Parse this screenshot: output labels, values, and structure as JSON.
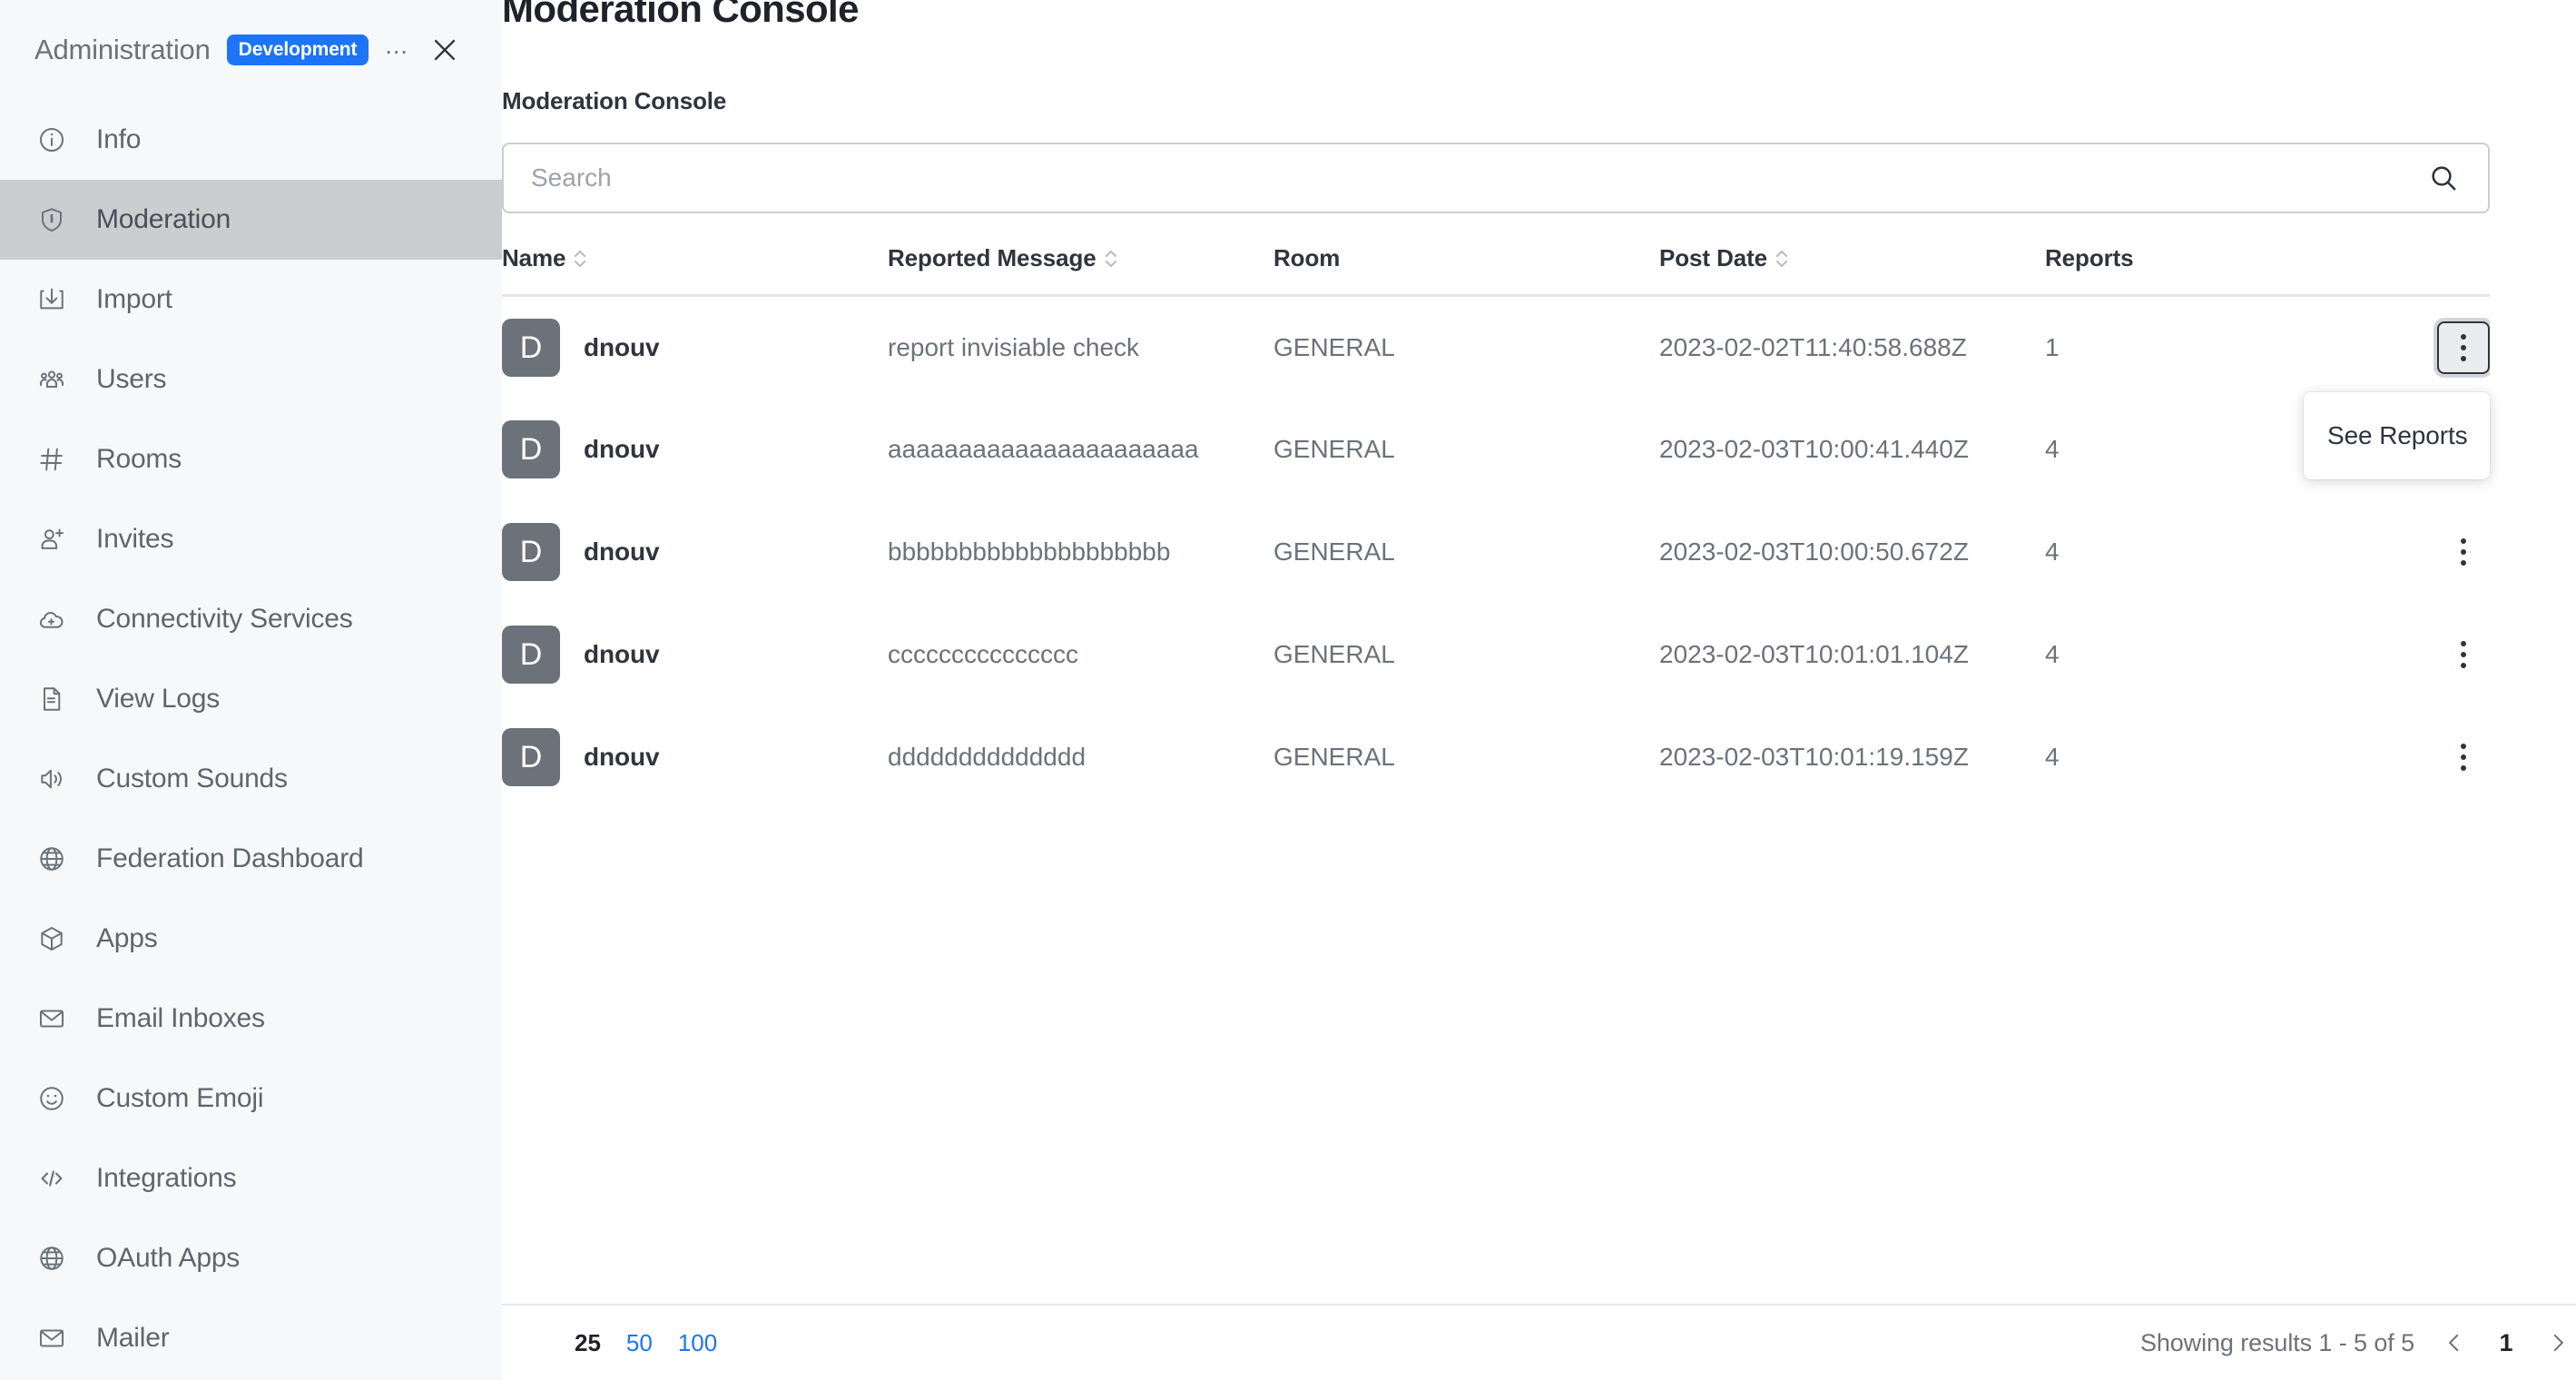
{
  "sidebar": {
    "title": "Administration",
    "badge": "Development",
    "ellipsis": "...",
    "close_icon": "close-icon",
    "items": [
      {
        "label": "Info",
        "icon": "info-circle-icon",
        "active": false
      },
      {
        "label": "Moderation",
        "icon": "shield-icon",
        "active": true
      },
      {
        "label": "Import",
        "icon": "import-download-icon",
        "active": false
      },
      {
        "label": "Users",
        "icon": "users-group-icon",
        "active": false
      },
      {
        "label": "Rooms",
        "icon": "hash-icon",
        "active": false
      },
      {
        "label": "Invites",
        "icon": "user-plus-icon",
        "active": false
      },
      {
        "label": "Connectivity Services",
        "icon": "cloud-plus-icon",
        "active": false
      },
      {
        "label": "View Logs",
        "icon": "document-lines-icon",
        "active": false
      },
      {
        "label": "Custom Sounds",
        "icon": "speaker-icon",
        "active": false
      },
      {
        "label": "Federation Dashboard",
        "icon": "globe-icon",
        "active": false
      },
      {
        "label": "Apps",
        "icon": "cube-icon",
        "active": false
      },
      {
        "label": "Email Inboxes",
        "icon": "envelope-icon",
        "active": false
      },
      {
        "label": "Custom Emoji",
        "icon": "smiley-icon",
        "active": false
      },
      {
        "label": "Integrations",
        "icon": "code-brackets-icon",
        "active": false
      },
      {
        "label": "OAuth Apps",
        "icon": "globe-icon",
        "active": false
      },
      {
        "label": "Mailer",
        "icon": "envelope-icon",
        "active": false
      }
    ]
  },
  "main": {
    "page_title": "Moderation Console",
    "section_label": "Moderation Console",
    "search": {
      "value": "",
      "placeholder": "Search",
      "icon": "search-icon"
    },
    "table": {
      "columns": [
        {
          "label": "Name",
          "sortable": true
        },
        {
          "label": "Reported Message",
          "sortable": true
        },
        {
          "label": "Room",
          "sortable": false
        },
        {
          "label": "Post Date",
          "sortable": true
        },
        {
          "label": "Reports",
          "sortable": false
        }
      ],
      "rows": [
        {
          "avatar_letter": "D",
          "name": "dnouv",
          "message": "report invisiable check",
          "room": "GENERAL",
          "post_date": "2023-02-02T11:40:58.688Z",
          "reports": "1",
          "menu_icon": "kebab-menu-icon"
        },
        {
          "avatar_letter": "D",
          "name": "dnouv",
          "message": "aaaaaaaaaaaaaaaaaaaaaa",
          "room": "GENERAL",
          "post_date": "2023-02-03T10:00:41.440Z",
          "reports": "4",
          "menu_icon": "kebab-menu-icon"
        },
        {
          "avatar_letter": "D",
          "name": "dnouv",
          "message": "bbbbbbbbbbbbbbbbbbbb",
          "room": "GENERAL",
          "post_date": "2023-02-03T10:00:50.672Z",
          "reports": "4",
          "menu_icon": "kebab-menu-icon"
        },
        {
          "avatar_letter": "D",
          "name": "dnouv",
          "message": "ccccccccccccccc",
          "room": "GENERAL",
          "post_date": "2023-02-03T10:01:01.104Z",
          "reports": "4",
          "menu_icon": "kebab-menu-icon"
        },
        {
          "avatar_letter": "D",
          "name": "dnouv",
          "message": "dddddddddddddd",
          "room": "GENERAL",
          "post_date": "2023-02-03T10:01:19.159Z",
          "reports": "4",
          "menu_icon": "kebab-menu-icon"
        }
      ]
    },
    "dropdown": {
      "open": true,
      "items": [
        "See Reports"
      ]
    },
    "footer": {
      "page_sizes": [
        {
          "label": "25",
          "active": true
        },
        {
          "label": "50",
          "active": false
        },
        {
          "label": "100",
          "active": false
        }
      ],
      "showing_text": "Showing results 1 - 5 of 5",
      "prev_icon": "chevron-left-icon",
      "next_icon": "chevron-right-icon",
      "current_page": "1"
    }
  },
  "colors": {
    "accent_blue": "#1d74f5",
    "sidebar_bg": "#f7f8fa",
    "sidebar_active": "#cbced1",
    "avatar_bg": "#6c727a",
    "text_primary": "#2f343d",
    "text_muted": "#6c727a",
    "border": "#cbced1"
  }
}
